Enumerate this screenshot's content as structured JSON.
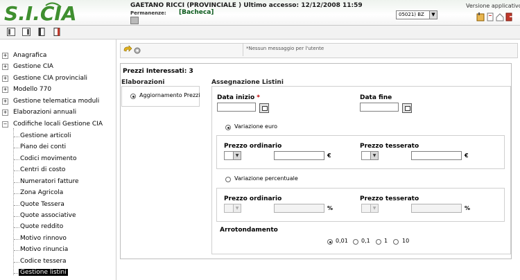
{
  "header": {
    "logo_text": "S.I.CIA",
    "user_line": "GAETANO RICCI (PROVINCIALE ) Ultimo accesso: 12/12/2008 11:59",
    "permanenze_label": "Permanenze:",
    "permanenze_value": "[Bacheca]",
    "selector_value": "05021) BZ",
    "version_label": "Versione applicativo",
    "colors": {
      "logo_green": "#3f8f2f",
      "accent_green": "#0b5a1c"
    }
  },
  "toolbar": {
    "icons": [
      "layout-left-icon",
      "layout-right-icon",
      "page-icon",
      "page-red-icon"
    ]
  },
  "sidebar": {
    "items": [
      {
        "label": "Anagrafica",
        "expanded": false
      },
      {
        "label": "Gestione CIA",
        "expanded": false
      },
      {
        "label": "Gestione CIA provinciali",
        "expanded": false
      },
      {
        "label": "Modello 770",
        "expanded": false
      },
      {
        "label": "Gestione telematica moduli",
        "expanded": false
      },
      {
        "label": "Elaborazioni annuali",
        "expanded": false
      },
      {
        "label": "Codifiche locali Gestione CIA",
        "expanded": true
      }
    ],
    "subitems": [
      "Gestione articoli",
      "Piano dei conti",
      "Codici movimento",
      "Centri di costo",
      "Numeratori fatture",
      "Zona Agricola",
      "Quote Tessera",
      "Quote associative",
      "Quote reddito",
      "Motivo rinnovo",
      "Motivo rinuncia",
      "Codice tessera",
      "Gestione listini"
    ],
    "active_subitem": "Gestione listini"
  },
  "message_bar": {
    "text": "*Nessun messaggio per l'utente"
  },
  "main": {
    "prezzi_interessati": "Prezzi Interessati: 3",
    "elaborazioni_title": "Elaborazioni",
    "elaborazioni_option": "Aggiornamento Prezzi",
    "assegnazione_title": "Assegnazione Listini",
    "data_inizio_label": "Data inizio",
    "required_mark": "*",
    "data_fine_label": "Data fine",
    "variazione_euro_label": "Variazione euro",
    "variazione_percentuale_label": "Variazione percentuale",
    "prezzo_ordinario_label": "Prezzo ordinario",
    "prezzo_tesserato_label": "Prezzo tesserato",
    "euro_symbol": "€",
    "percent_symbol": "%",
    "arrotondamento_label": "Arrotondamento",
    "rounding_options": [
      "0,01",
      "0,1",
      "1",
      "10"
    ],
    "rounding_selected": "0,01"
  }
}
